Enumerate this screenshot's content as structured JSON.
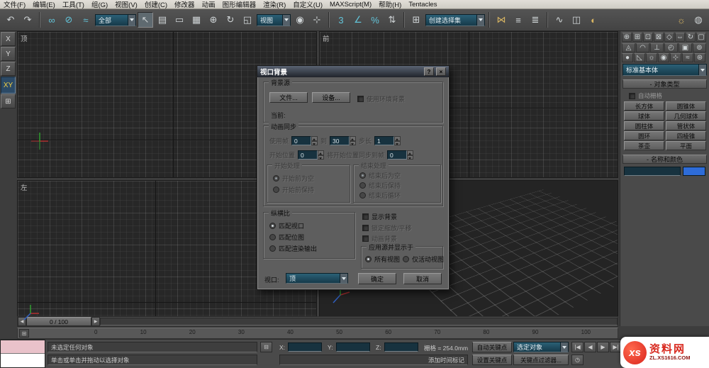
{
  "menubar": {
    "items": [
      "文件(F)",
      "编辑(E)",
      "工具(T)",
      "组(G)",
      "视图(V)",
      "创建(C)",
      "修改器",
      "动画",
      "图形编辑器",
      "渲染(R)",
      "自定义(U)",
      "MAXScript(M)",
      "帮助(H)",
      "Tentacles"
    ]
  },
  "toolbar": {
    "filter_dropdown": "全部",
    "coord_dropdown": "视图",
    "selection_set": "创建选择集",
    "icons": {
      "undo": "↶",
      "redo": "↷",
      "link": "∞",
      "unlink": "⊘",
      "bind": "≈",
      "select": "↖",
      "select_by_name": "▤",
      "region": "▭",
      "crossing": "▦",
      "move": "⊕",
      "rotate": "↻",
      "scale": "◱",
      "pivot": "◉",
      "manipulate": "⊹",
      "snap3": "3",
      "angle_snap": "∠",
      "percent_snap": "%",
      "spinner_snap": "⇅",
      "named_sets": "⊞",
      "mirror": "⋈",
      "align": "≡",
      "layers": "≣",
      "curve": "∿",
      "schematic": "◫",
      "material": "◐",
      "render_setup": "☼",
      "render": "◍"
    }
  },
  "axisbar": {
    "x": "X",
    "y": "Y",
    "z": "Z",
    "xy": "XY",
    "extra": "⊞"
  },
  "viewports": {
    "top": "顶",
    "front": "前",
    "left": "左"
  },
  "navicons": {
    "zoom": "⊕",
    "zoom_all": "⊞",
    "extents": "⊡",
    "extents_all": "⊠",
    "fov": "◇",
    "pan": "⇔",
    "orbit": "↻",
    "maximize": "▢"
  },
  "tabs": {
    "create": "◬",
    "modify": "◠",
    "hierarchy": "⊥",
    "motion": "◴",
    "display": "▣",
    "utilities": "⊚"
  },
  "subcats": {
    "geometry": "●",
    "shapes": "◺",
    "lights": "☼",
    "cameras": "◉",
    "helpers": "⊹",
    "spacewarps": "≈",
    "systems": "⊛"
  },
  "panel": {
    "category": "标准基本体",
    "collapse": "-",
    "object_type": "对象类型",
    "autogrid": "自动栅格",
    "b": [
      "长方体",
      "圆锥体",
      "球体",
      "几何球体",
      "圆柱体",
      "管状体",
      "圆环",
      "四棱锥",
      "茶壶",
      "平面"
    ],
    "name_color": "名称和颜色",
    "swatch_color": "#2e6cd8"
  },
  "dialog": {
    "title": "视口背景",
    "help": "?",
    "close": "×",
    "src": {
      "title": "背景源",
      "file": "文件...",
      "device": "设备...",
      "use_env": "使用环境背景",
      "current": "当前:"
    },
    "anim": {
      "title": "动画同步",
      "use_frame": "使用帧",
      "to": "到",
      "step": "步长",
      "start_at": "开始位置",
      "sync_to": "将开始位置同步到帧",
      "v_use": "0",
      "v_to": "30",
      "v_step": "1",
      "v_start": "0",
      "v_sync": "0",
      "start": {
        "title": "开始处理",
        "o1": "开始前为空",
        "o2": "开始前保持"
      },
      "end": {
        "title": "结束处理",
        "o1": "结束后为空",
        "o2": "结束后保持",
        "o3": "结束后循环"
      }
    },
    "aspect": {
      "title": "纵横比",
      "o1": "匹配视口",
      "o2": "匹配位图",
      "o3": "匹配渲染输出"
    },
    "display": {
      "show": "显示背景",
      "lock": "锁定缩放/平移",
      "anim_bg": "动画背景"
    },
    "apply": {
      "title": "应用源并显示于",
      "o1": "所有视图",
      "o2": "仅活动视图"
    },
    "viewport_label": "视口:",
    "viewport_value": "顶",
    "ok": "确定",
    "cancel": "取消"
  },
  "timeline": {
    "frame": "0 / 100",
    "left": "◀",
    "right": "▶",
    "tb_icon": "⊞",
    "ticks": [
      "0",
      "10",
      "20",
      "30",
      "40",
      "50",
      "60",
      "70",
      "80",
      "90",
      "100"
    ]
  },
  "status": {
    "prompt1": "未选定任何对象",
    "prompt2": "单击或单击并拖动以选择对象",
    "lock_icon": "⊟",
    "xl": "X:",
    "yl": "Y:",
    "zl": "Z:",
    "grid": "栅格 = 254.0mm",
    "time_tag": "添加时间标记",
    "auto_key": "自动关键点",
    "set_key": "设置关键点",
    "sel_set": "选定对象",
    "key_filters": "关键点过滤器...",
    "play": {
      "start": "|◀",
      "prev": "◀",
      "playb": "▶",
      "end": "▶|",
      "clock": "◷"
    }
  },
  "watermark": {
    "logo": "xs",
    "name": "资料网",
    "url": "ZL.XS1616.COM"
  }
}
